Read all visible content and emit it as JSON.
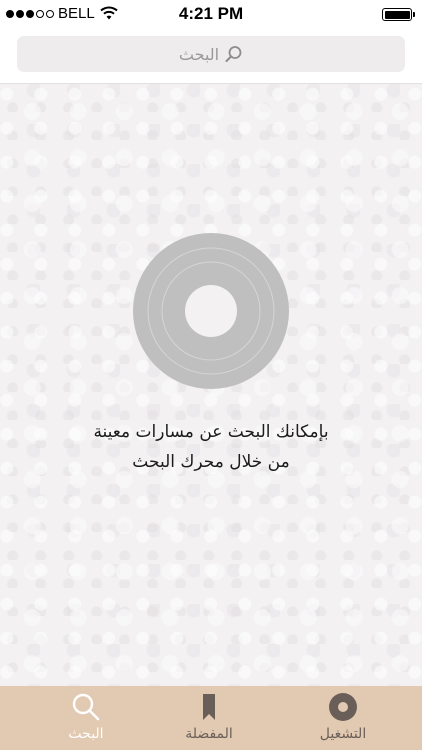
{
  "status_bar": {
    "signal_dots": [
      true,
      true,
      true,
      false,
      false
    ],
    "carrier": "BELL",
    "time": "4:21 PM",
    "battery_level": 1.0
  },
  "search": {
    "placeholder": "البحث",
    "icon": "search-icon"
  },
  "empty_state": {
    "icon": "disc-icon",
    "line1": "بإمكانك البحث عن مسارات معينة",
    "line2": "من خلال محرك البحث"
  },
  "tabs": [
    {
      "label": "البحث",
      "icon": "search-icon",
      "active": true
    },
    {
      "label": "المفضلة",
      "icon": "bookmark-icon",
      "active": false
    },
    {
      "label": "التشغيل",
      "icon": "disc-icon",
      "active": false
    }
  ],
  "colors": {
    "tab_bar_background": "#e2c9b1",
    "tab_active": "#ffffff",
    "tab_inactive": "#6a5f58",
    "disc": "#c0bfbf",
    "background": "#f3f1f2"
  }
}
